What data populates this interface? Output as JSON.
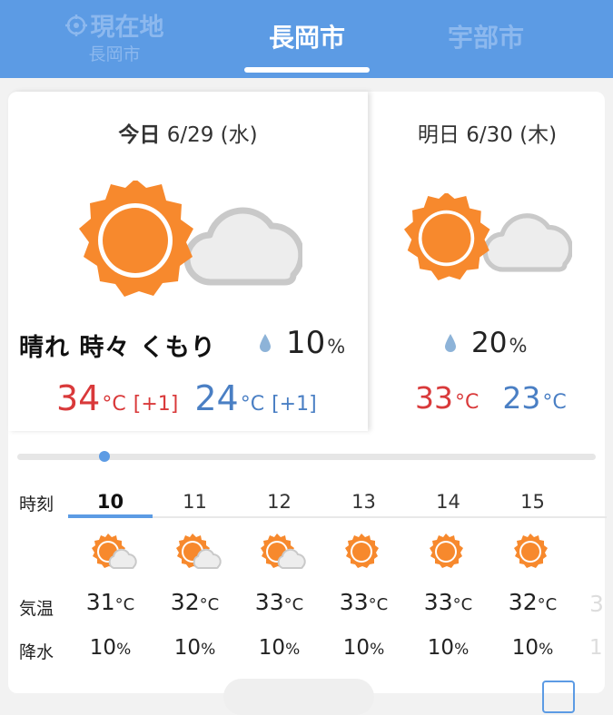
{
  "header": {
    "tabs": [
      {
        "label": "現在地",
        "sub": "長岡市"
      },
      {
        "label": "長岡市"
      },
      {
        "label": "宇部市"
      }
    ]
  },
  "today": {
    "heading_label": "今日",
    "date": "6/29 (水)",
    "icon": "sun-cloud-icon",
    "condition": "晴れ 時々 くもり",
    "rain_value": "10",
    "rain_unit": "%",
    "high": "34",
    "high_unit": "°C",
    "high_diff": "[+1]",
    "low": "24",
    "low_unit": "°C",
    "low_diff": "[+1]"
  },
  "tomorrow": {
    "heading_label": "明日",
    "date": "6/30 (木)",
    "icon": "sun-cloud-icon",
    "rain_value": "20",
    "rain_unit": "%",
    "high": "33",
    "high_unit": "°C",
    "low": "23",
    "low_unit": "°C"
  },
  "hourly": {
    "labels": {
      "time": "時刻",
      "temp": "気温",
      "rain": "降水"
    },
    "unit_c": "°C",
    "unit_pct": "%",
    "hours": [
      {
        "hour": "10",
        "icon": "sun-cloud-icon",
        "temp": "31",
        "rain": "10"
      },
      {
        "hour": "11",
        "icon": "sun-cloud-icon",
        "temp": "32",
        "rain": "10"
      },
      {
        "hour": "12",
        "icon": "sun-cloud-icon",
        "temp": "33",
        "rain": "10"
      },
      {
        "hour": "13",
        "icon": "sun-icon",
        "temp": "33",
        "rain": "10"
      },
      {
        "hour": "14",
        "icon": "sun-icon",
        "temp": "33",
        "rain": "10"
      },
      {
        "hour": "15",
        "icon": "sun-icon",
        "temp": "32",
        "rain": "10"
      }
    ]
  },
  "colors": {
    "header": "#5c9be4",
    "high": "#d9393a",
    "low": "#4a7fc4",
    "sun": "#f7892d"
  }
}
